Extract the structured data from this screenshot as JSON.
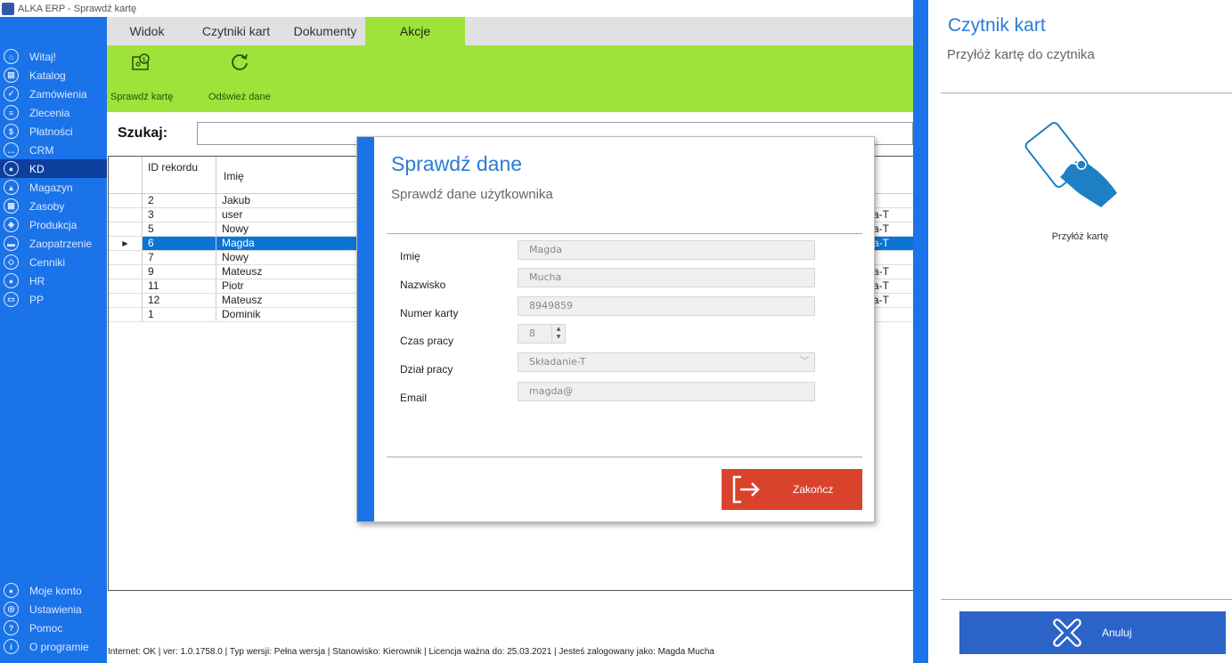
{
  "window": {
    "title": "ALKA ERP - Sprawdź kartę"
  },
  "sidebar": {
    "items": [
      {
        "label": "Witaj!",
        "icon": "home-icon",
        "glyph": "⌂"
      },
      {
        "label": "Katalog",
        "icon": "book-icon",
        "glyph": "▤"
      },
      {
        "label": "Zamówienia",
        "icon": "cart-icon",
        "glyph": "✓"
      },
      {
        "label": "Zlecenia",
        "icon": "list-icon",
        "glyph": "≡"
      },
      {
        "label": "Płatności",
        "icon": "dollar-icon",
        "glyph": "$"
      },
      {
        "label": "CRM",
        "icon": "chat-icon",
        "glyph": "…"
      },
      {
        "label": "KD",
        "icon": "person-icon",
        "glyph": "●"
      },
      {
        "label": "Magazyn",
        "icon": "warehouse-icon",
        "glyph": "▲"
      },
      {
        "label": "Zasoby",
        "icon": "box-icon",
        "glyph": "▦"
      },
      {
        "label": "Produkcja",
        "icon": "production-icon",
        "glyph": "◆"
      },
      {
        "label": "Zaopatrzenie",
        "icon": "truck-icon",
        "glyph": "▬"
      },
      {
        "label": "Cenniki",
        "icon": "tag-icon",
        "glyph": "◇"
      },
      {
        "label": "HR",
        "icon": "hr-icon",
        "glyph": "●"
      },
      {
        "label": "PP",
        "icon": "pp-icon",
        "glyph": "▭"
      }
    ],
    "bottom_items": [
      {
        "label": "Moje konto",
        "icon": "account-icon",
        "glyph": "●"
      },
      {
        "label": "Ustawienia",
        "icon": "settings-icon",
        "glyph": "◎"
      },
      {
        "label": "Pomoc",
        "icon": "help-icon",
        "glyph": "?"
      },
      {
        "label": "O programie",
        "icon": "info-icon",
        "glyph": "i"
      }
    ]
  },
  "tabs": [
    "Widok",
    "Czytniki kart",
    "Dokumenty",
    "Akcje"
  ],
  "ribbon": {
    "check_card": "Sprawdź kartę",
    "refresh": "Odśwież dane"
  },
  "search": {
    "label": "Szukaj:",
    "value": ""
  },
  "table": {
    "headers": [
      "ID rekordu",
      "Imię"
    ],
    "rows": [
      {
        "id": "2",
        "name": "Jakub",
        "extra": ""
      },
      {
        "id": "3",
        "name": "user",
        "extra": "a-T"
      },
      {
        "id": "5",
        "name": "Nowy",
        "extra": "a-T"
      },
      {
        "id": "6",
        "name": "Magda",
        "extra": "a-T"
      },
      {
        "id": "7",
        "name": "Nowy",
        "extra": ""
      },
      {
        "id": "9",
        "name": "Mateusz",
        "extra": "a-T"
      },
      {
        "id": "11",
        "name": "Piotr",
        "extra": "a-T"
      },
      {
        "id": "12",
        "name": "Mateusz",
        "extra": "a-T"
      },
      {
        "id": "1",
        "name": "Dominik",
        "extra": ""
      }
    ],
    "selected_row_pointer": "▶"
  },
  "statusbar": {
    "text": "Internet: OK  |  ver: 1.0.1758.0  |  Typ wersji: Pełna wersja  |  Stanowisko: Kierownik  |  Licencja ważna do: 25.03.2021  |  Jesteś zalogowany jako: Magda Mucha"
  },
  "dialog": {
    "title": "Sprawdź dane",
    "subtitle": "Sprawdź dane użytkownika",
    "fields": {
      "first_name_label": "Imię",
      "first_name_value": "Magda",
      "last_name_label": "Nazwisko",
      "last_name_value": "Mucha",
      "card_label": "Numer karty",
      "card_value": "8949859",
      "hours_label": "Czas pracy",
      "hours_value": "8",
      "dept_label": "Dział pracy",
      "dept_value": "Składanie-T",
      "email_label": "Email",
      "email_value": "magda@"
    },
    "finish_label": "Zakończ"
  },
  "reader_panel": {
    "title": "Czytnik kart",
    "subtitle": "Przyłóż kartę do czytnika",
    "caption": "Przyłóż kartę",
    "cancel_label": "Anuluj"
  },
  "colors": {
    "sidebar": "#1a73e8",
    "ribbon": "#9de33a",
    "selected_row": "#0a74d6",
    "finish_button": "#d9432c",
    "cancel_button": "#2b63c9",
    "title_blue": "#2b7bd6"
  }
}
